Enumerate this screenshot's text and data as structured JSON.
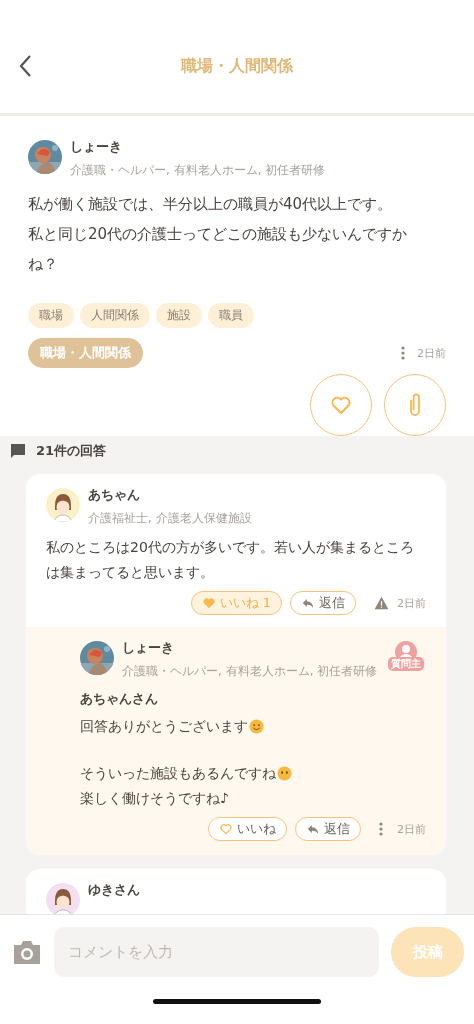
{
  "header": {
    "title": "職場・人間関係"
  },
  "post": {
    "author": {
      "name": "しょーき",
      "profile": "介護職・ヘルパー, 有料老人ホーム, 初任者研修"
    },
    "body": [
      "私が働く施設では、半分以上の職員が40代以上です。",
      "私と同じ20代の介護士ってどこの施設も少ないんですかね？"
    ],
    "tags": [
      "職場",
      "人間関係",
      "施設",
      "職員"
    ],
    "category": "職場・人間関係",
    "time": "2日前",
    "liked": false
  },
  "answers": {
    "count_label": "21件の回答",
    "items": [
      {
        "author": {
          "name": "あちゃん",
          "profile": "介護福祉士, 介護老人保健施設",
          "avatar": {
            "kind": "illustration",
            "color": "#fbf1c8"
          }
        },
        "body": "私のところは20代の方が多いです。若い人が集まるところは集まってると思います。",
        "like": {
          "label": "いいね 1",
          "selected": true
        },
        "reply_label": "返信",
        "menu": {
          "kind": "report"
        },
        "time": "2日前",
        "replies": [
          {
            "author": {
              "name": "しょーき",
              "profile": "介護職・ヘルパー, 有料老人ホーム, 初任者研修"
            },
            "badge": "質問主",
            "addressee": "あちゃんさん",
            "paragraphs": [
              [
                {
                  "text": "回答ありがとうございます",
                  "emoji": {
                    "kind": "smile"
                  }
                }
              ],
              [
                {
                  "text": "そういった施設もあるんですね",
                  "emoji": {
                    "kind": "neutral"
                  }
                },
                {
                  "text": "楽しく働けそうですね♪"
                }
              ]
            ],
            "like": {
              "label": "いいね",
              "selected": false
            },
            "reply_label": "返信",
            "menu": {
              "kind": "more"
            },
            "time": "2日前"
          }
        ]
      },
      {
        "author": {
          "name": "ゆきさん",
          "avatar": {
            "kind": "illustration",
            "color": "#f3dff0"
          }
        }
      }
    ]
  },
  "composer": {
    "placeholder": "コメントを入力",
    "submit": "投稿"
  }
}
